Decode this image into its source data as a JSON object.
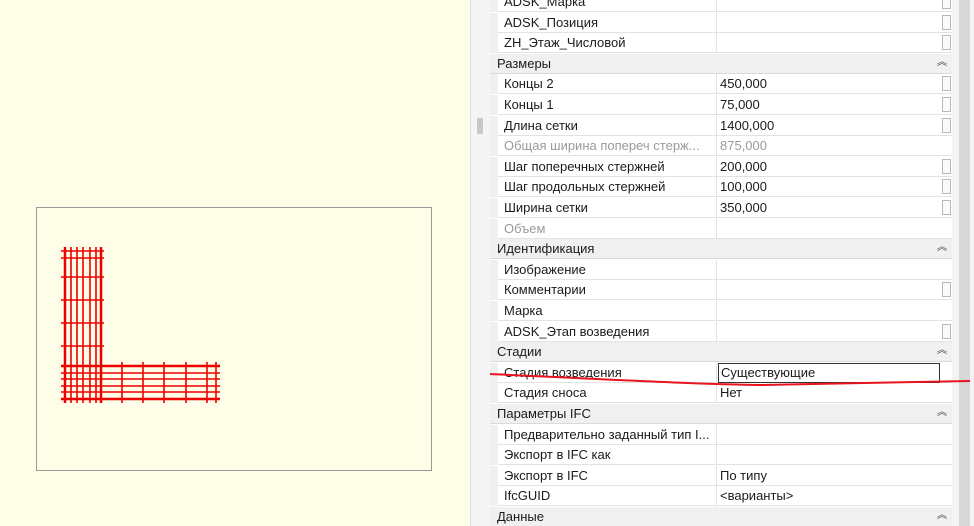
{
  "properties": {
    "rows": [
      {
        "kind": "prop",
        "name": "ADSK_Марка",
        "value": "",
        "checkbox": true
      },
      {
        "kind": "prop",
        "name": "ADSK_Позиция",
        "value": "",
        "checkbox": true
      },
      {
        "kind": "prop",
        "name": "ZH_Этаж_Числовой",
        "value": "",
        "checkbox": true
      },
      {
        "kind": "group",
        "name": "Размеры"
      },
      {
        "kind": "prop",
        "name": "Концы 2",
        "value": "450,000",
        "checkbox": true
      },
      {
        "kind": "prop",
        "name": "Концы 1",
        "value": "75,000",
        "checkbox": true
      },
      {
        "kind": "prop",
        "name": "Длина сетки",
        "value": "1400,000",
        "checkbox": true
      },
      {
        "kind": "prop",
        "name": "Общая ширина попереч стерж...",
        "value": "875,000",
        "checkbox": false,
        "disabled": true
      },
      {
        "kind": "prop",
        "name": "Шаг поперечных стержней",
        "value": "200,000",
        "checkbox": true
      },
      {
        "kind": "prop",
        "name": "Шаг продольных стержней",
        "value": "100,000",
        "checkbox": true
      },
      {
        "kind": "prop",
        "name": "Ширина сетки",
        "value": "350,000",
        "checkbox": true
      },
      {
        "kind": "prop",
        "name": "Объем",
        "value": "",
        "checkbox": false,
        "disabled": true
      },
      {
        "kind": "group",
        "name": "Идентификация"
      },
      {
        "kind": "prop",
        "name": "Изображение",
        "value": "",
        "checkbox": false
      },
      {
        "kind": "prop",
        "name": "Комментарии",
        "value": "",
        "checkbox": true
      },
      {
        "kind": "prop",
        "name": "Марка",
        "value": "",
        "checkbox": false
      },
      {
        "kind": "prop",
        "name": "ADSK_Этап возведения",
        "value": "",
        "checkbox": true
      },
      {
        "kind": "group",
        "name": "Стадии"
      },
      {
        "kind": "prop",
        "name": "Стадия возведения",
        "value": "Существующие",
        "checkbox": false,
        "editing": true
      },
      {
        "kind": "prop",
        "name": "Стадия сноса",
        "value": "Нет",
        "checkbox": false
      },
      {
        "kind": "group",
        "name": "Параметры IFC"
      },
      {
        "kind": "prop",
        "name": "Предварительно заданный тип I...",
        "value": "",
        "checkbox": false
      },
      {
        "kind": "prop",
        "name": "Экспорт в IFC как",
        "value": "",
        "checkbox": false
      },
      {
        "kind": "prop",
        "name": "Экспорт в IFC",
        "value": "По типу",
        "checkbox": false
      },
      {
        "kind": "prop",
        "name": "IfcGUID",
        "value": "<варианты>",
        "checkbox": false
      },
      {
        "kind": "group",
        "name": "Данные"
      }
    ]
  },
  "icons": {
    "collapse": "chevron-double-up-icon"
  },
  "colors": {
    "rebar": "#ee0000",
    "annotation": "#e8141e",
    "viewBackground": "#fefde8"
  }
}
